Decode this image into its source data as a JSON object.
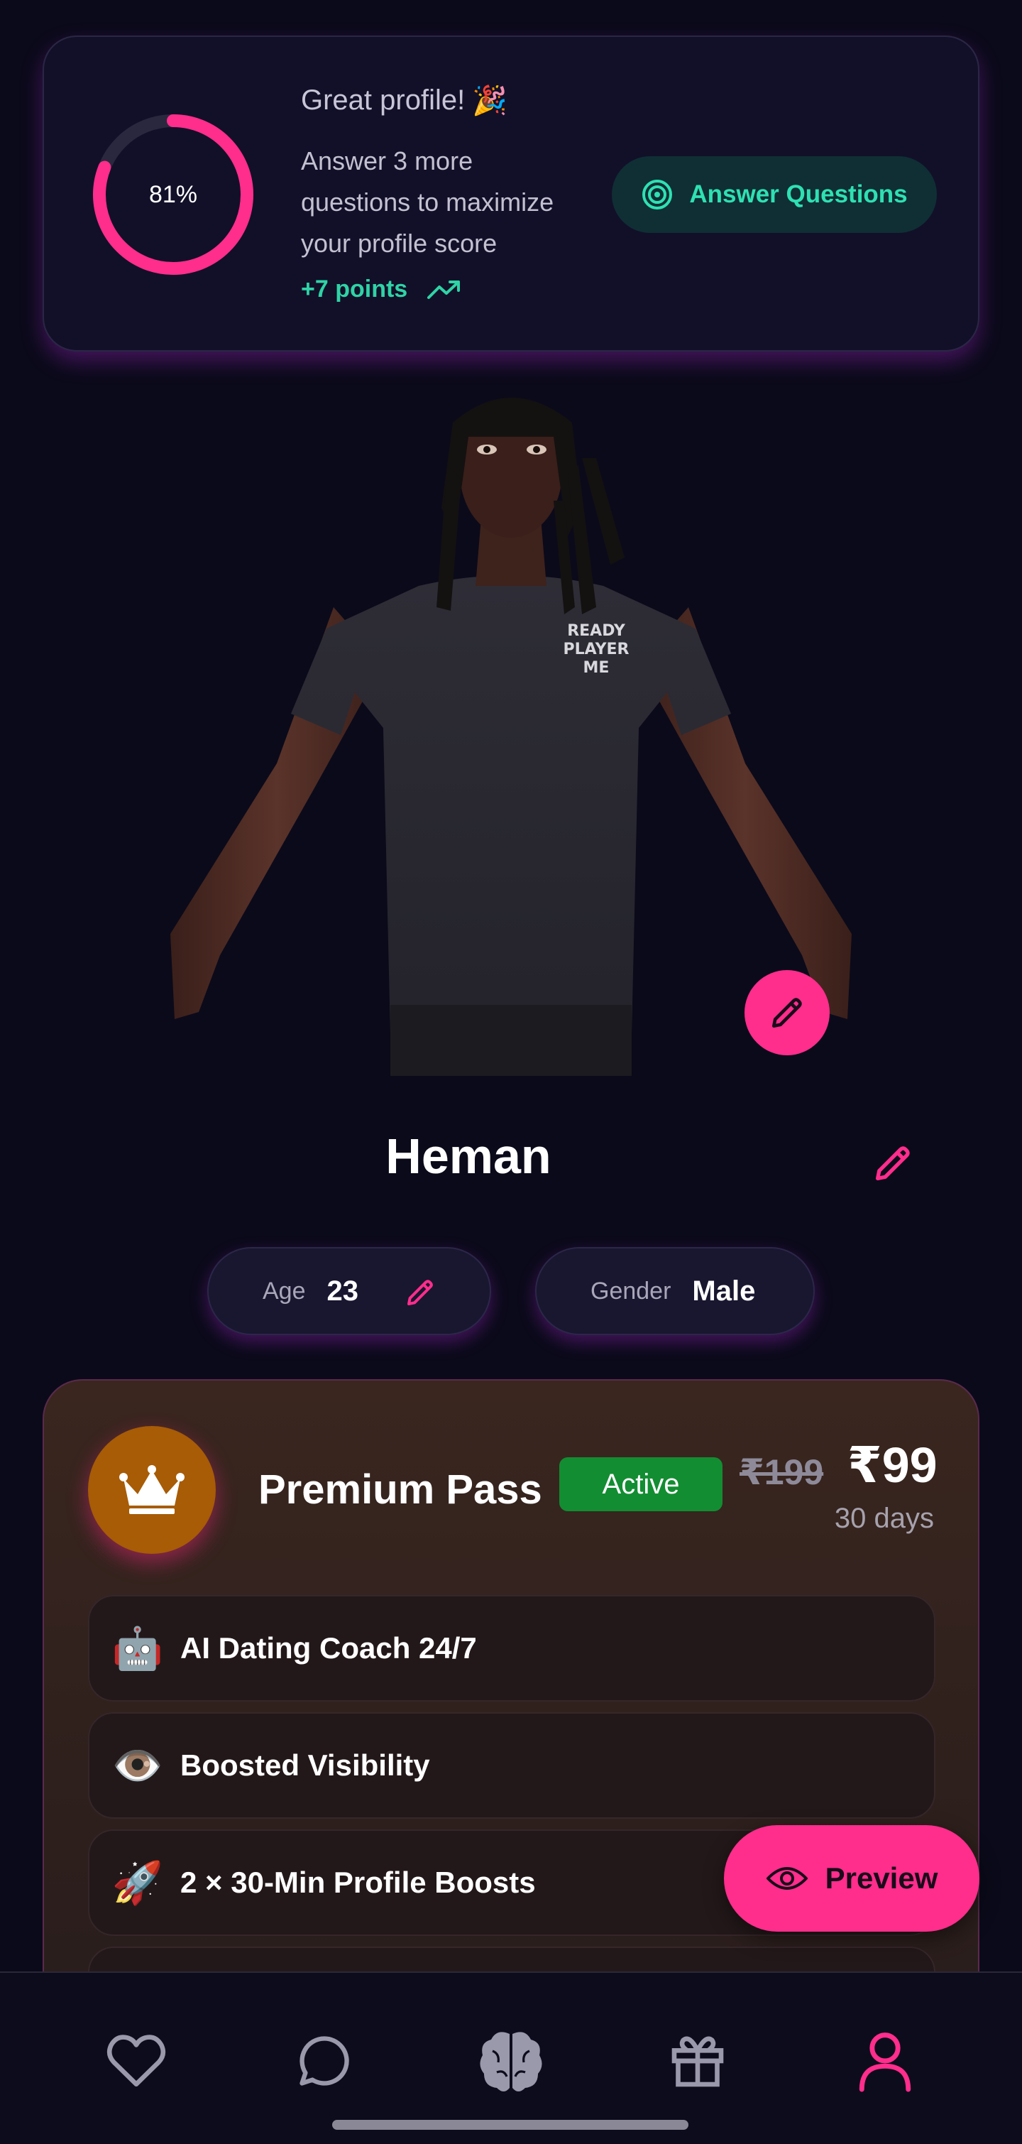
{
  "profile_score": {
    "percent_label": "81%",
    "percent_value": 81,
    "title": "Great profile!",
    "title_emoji": "🎉",
    "description": "Answer 3 more questions to maximize your profile score",
    "points": "+7 points",
    "button_label": "Answer Questions"
  },
  "profile": {
    "name": "Heman",
    "age_label": "Age",
    "age_value": "23",
    "gender_label": "Gender",
    "gender_value": "Male",
    "avatar_shirt_text": [
      "READY",
      "PLAYER",
      "ME"
    ]
  },
  "premium": {
    "title": "Premium Pass",
    "status": "Active",
    "old_price": "₹199",
    "new_price": "₹99",
    "duration": "30 days",
    "features": [
      {
        "emoji": "🤖",
        "label": "AI Dating Coach 24/7"
      },
      {
        "emoji": "👁️",
        "label": "Boosted Visibility"
      },
      {
        "emoji": "🚀",
        "label": "2 × 30-Min Profile Boosts"
      }
    ]
  },
  "preview_button": {
    "label": "Preview"
  },
  "bottom_nav": {
    "items": [
      {
        "icon": "heart-icon",
        "active": false
      },
      {
        "icon": "chat-icon",
        "active": false
      },
      {
        "icon": "brain-icon",
        "active": false
      },
      {
        "icon": "gift-icon",
        "active": false
      },
      {
        "icon": "profile-icon",
        "active": true
      }
    ]
  },
  "colors": {
    "background": "#0b0a1a",
    "accent_pink": "#ff2d8c",
    "accent_teal": "#2fe0b3",
    "active_green": "#138d32",
    "crown_orange": "#a75c05"
  }
}
